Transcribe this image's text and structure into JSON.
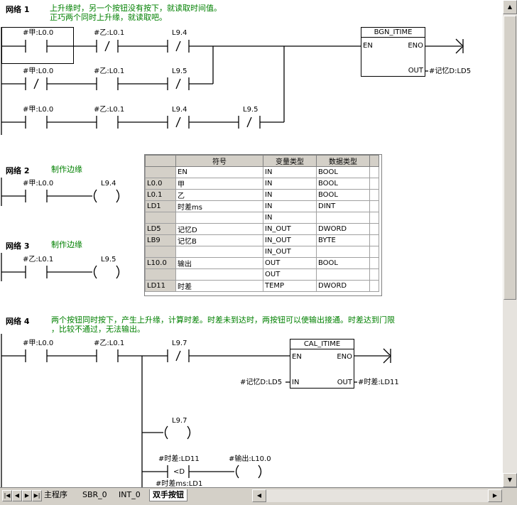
{
  "networks": [
    {
      "title": "网络 1",
      "comment": "上升缘时，另一个按钮没有按下，就读取时间值。\n正巧两个同时上升缘，就读取吧。"
    },
    {
      "title": "网络 2",
      "comment": "制作边缘"
    },
    {
      "title": "网络 3",
      "comment": "制作边缘"
    },
    {
      "title": "网络 4",
      "comment": "两个按钮同时按下，产生上升缘，计算时差。时差未到达时，两按钮可以使输出接通。时差达到门限\n，比较不通过，无法输出。"
    }
  ],
  "contacts": {
    "n1_r1_c1": "#甲:L0.0",
    "n1_r1_c2": "#乙:L0.1",
    "n1_r1_c3": "L9.4",
    "n1_r2_c1": "#甲:L0.0",
    "n1_r2_c2": "#乙:L0.1",
    "n1_r2_c3": "L9.5",
    "n1_r3_c1": "#甲:L0.0",
    "n1_r3_c2": "#乙:L0.1",
    "n1_r3_c3": "L9.4",
    "n1_r3_c4": "L9.5",
    "n2_c1": "#甲:L0.0",
    "n2_coil": "L9.4",
    "n3_c1": "#乙:L0.1",
    "n3_coil": "L9.5",
    "n4_c1": "#甲:L0.0",
    "n4_c2": "#乙:L0.1",
    "n4_c3": "L9.7",
    "n4_coil1": "L9.7",
    "n4_cmp_top": "#时差:LD11",
    "n4_cmp_bottom": "#时差ms:LD1",
    "n4_cmp_op": "<D",
    "n4_coil2": "#输出:L10.0"
  },
  "boxes": {
    "bgn": {
      "name": "BGN_ITIME",
      "en": "EN",
      "eno": "ENO",
      "out": "OUT",
      "out_var": "#记忆D:LD5"
    },
    "cal": {
      "name": "CAL_ITIME",
      "en": "EN",
      "eno": "ENO",
      "in": "IN",
      "out": "OUT",
      "in_var": "#记忆D:LD5",
      "out_var": "#时差:LD11"
    }
  },
  "symtab": {
    "headers": [
      "",
      "符号",
      "变量类型",
      "数据类型"
    ],
    "rows": [
      [
        "",
        "EN",
        "IN",
        "BOOL"
      ],
      [
        "L0.0",
        "甲",
        "IN",
        "BOOL"
      ],
      [
        "L0.1",
        "乙",
        "IN",
        "BOOL"
      ],
      [
        "LD1",
        "时差ms",
        "IN",
        "DINT"
      ],
      [
        "",
        "",
        "IN",
        ""
      ],
      [
        "LD5",
        "记忆D",
        "IN_OUT",
        "DWORD"
      ],
      [
        "LB9",
        "记忆B",
        "IN_OUT",
        "BYTE"
      ],
      [
        "",
        "",
        "IN_OUT",
        ""
      ],
      [
        "L10.0",
        "输出",
        "OUT",
        "BOOL"
      ],
      [
        "",
        "",
        "OUT",
        ""
      ],
      [
        "LD11",
        "时差",
        "TEMP",
        "DWORD"
      ]
    ]
  },
  "tabs": [
    "主程序",
    "SBR_0",
    "INT_0",
    "双手按钮"
  ],
  "active_tab": "双手按钮"
}
